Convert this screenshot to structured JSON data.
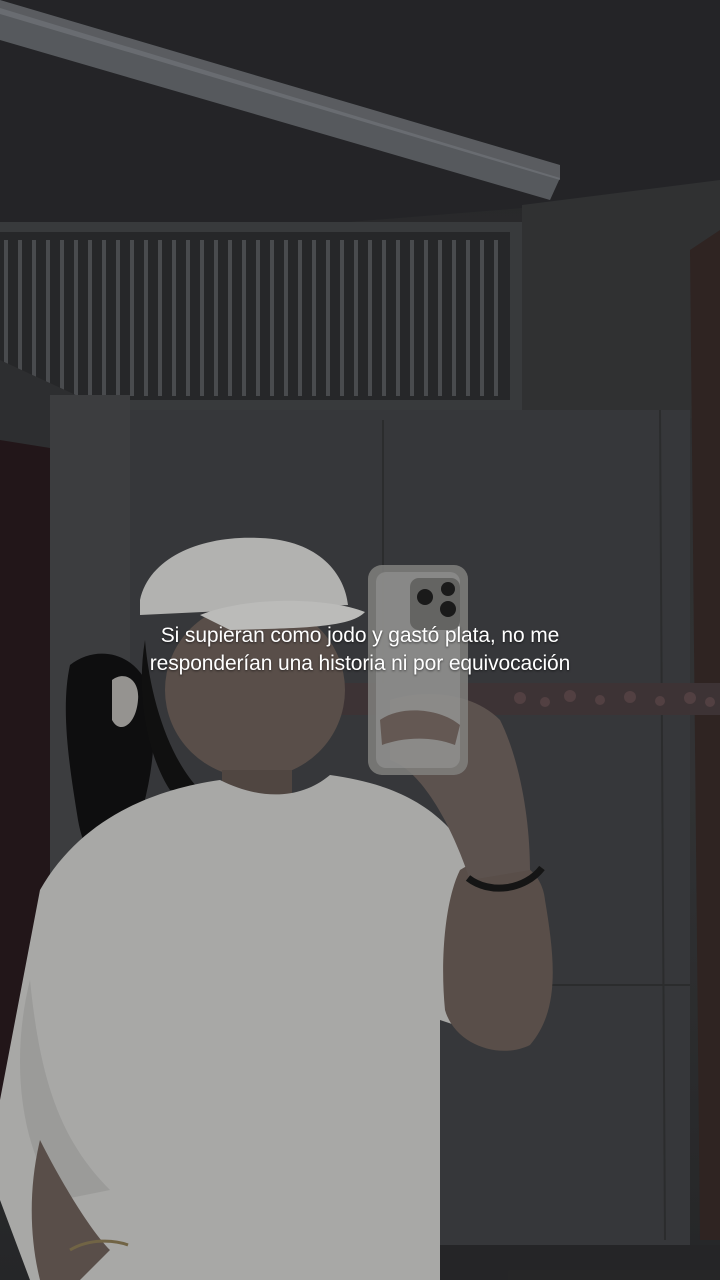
{
  "story": {
    "caption": "Si supieran como jodo y gastó plata, no me responderían una historia ni por equivocación"
  },
  "photo": {
    "subject": "mirror-selfie"
  }
}
